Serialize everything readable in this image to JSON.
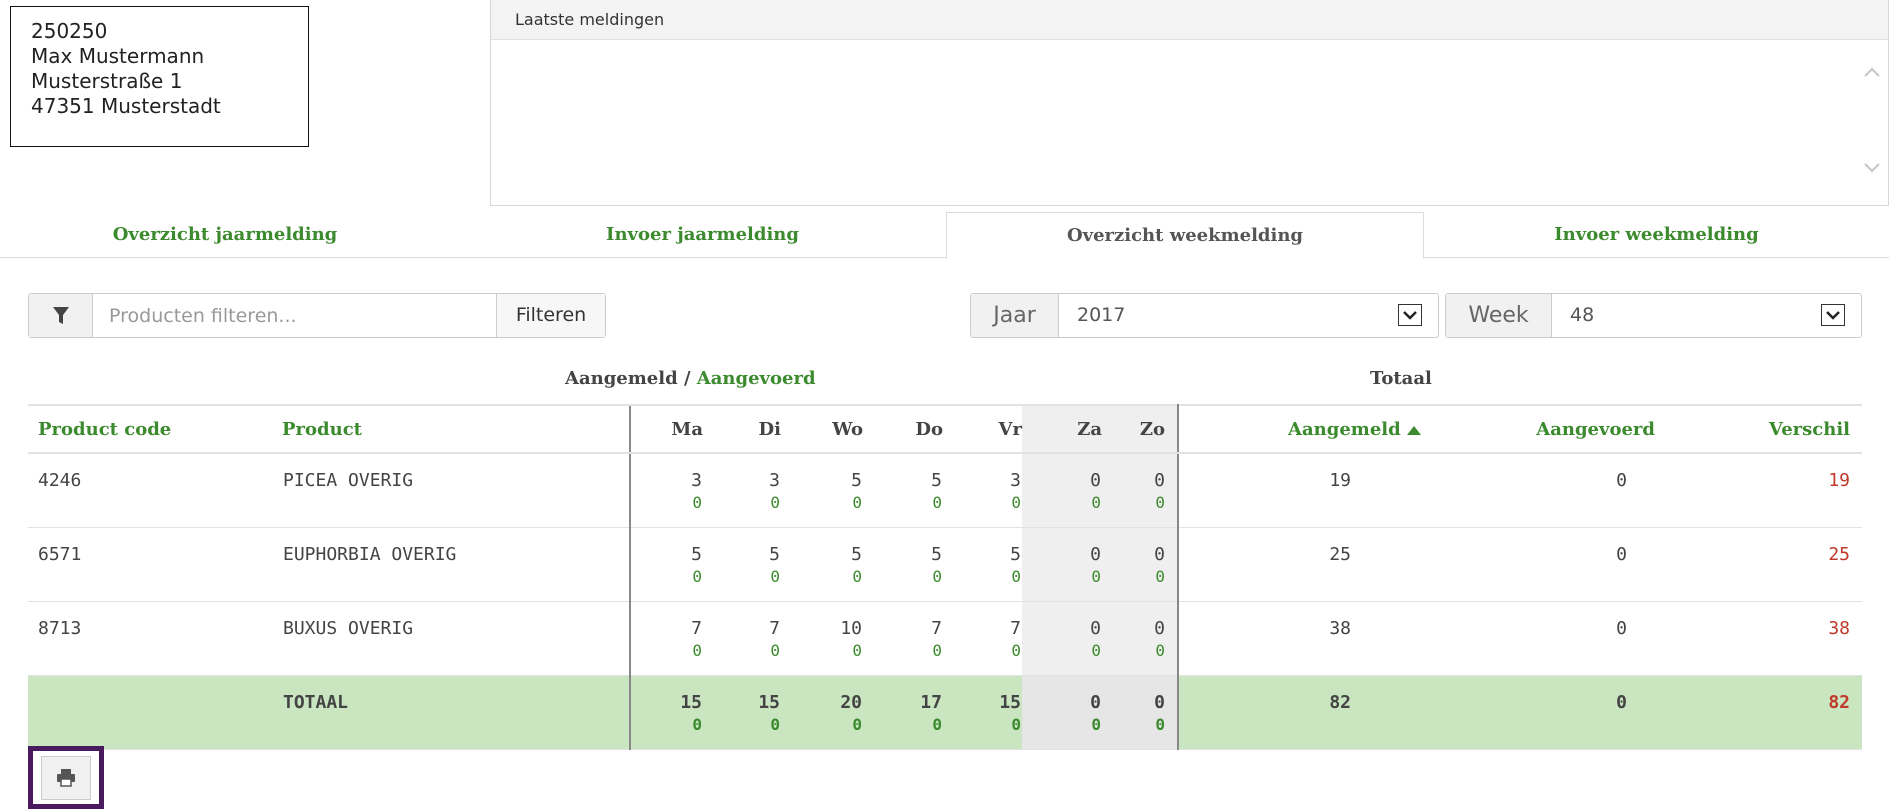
{
  "address": {
    "line1": "250250",
    "line2": "Max Mustermann",
    "line3": "Musterstraße 1",
    "line4": "47351 Musterstadt"
  },
  "notifications": {
    "title": "Laatste meldingen"
  },
  "tabs": [
    {
      "label": "Overzicht jaarmelding",
      "active": false
    },
    {
      "label": "Invoer jaarmelding",
      "active": false
    },
    {
      "label": "Overzicht weekmelding",
      "active": true
    },
    {
      "label": "Invoer weekmelding",
      "active": false
    }
  ],
  "filter": {
    "placeholder": "Producten filteren...",
    "button": "Filteren"
  },
  "year": {
    "label": "Jaar",
    "value": "2017"
  },
  "week": {
    "label": "Week",
    "value": "48"
  },
  "group_headers": {
    "aangemeld": "Aangemeld / ",
    "aangevoerd": "Aangevoerd",
    "totaal": "Totaal"
  },
  "columns": {
    "code": "Product code",
    "product": "Product",
    "days": [
      "Ma",
      "Di",
      "Wo",
      "Do",
      "Vr",
      "Za",
      "Zo"
    ],
    "aangemeld": "Aangemeld",
    "aangevoerd": "Aangevoerd",
    "verschil": "Verschil"
  },
  "rows": [
    {
      "code": "4246",
      "product": "PICEA OVERIG",
      "d": [
        [
          "3",
          "0"
        ],
        [
          "3",
          "0"
        ],
        [
          "5",
          "0"
        ],
        [
          "5",
          "0"
        ],
        [
          "3",
          "0"
        ],
        [
          "0",
          "0"
        ],
        [
          "0",
          "0"
        ]
      ],
      "aangemeld": "19",
      "aangevoerd": "0",
      "verschil": "19"
    },
    {
      "code": "6571",
      "product": "EUPHORBIA OVERIG",
      "d": [
        [
          "5",
          "0"
        ],
        [
          "5",
          "0"
        ],
        [
          "5",
          "0"
        ],
        [
          "5",
          "0"
        ],
        [
          "5",
          "0"
        ],
        [
          "0",
          "0"
        ],
        [
          "0",
          "0"
        ]
      ],
      "aangemeld": "25",
      "aangevoerd": "0",
      "verschil": "25"
    },
    {
      "code": "8713",
      "product": "BUXUS OVERIG",
      "d": [
        [
          "7",
          "0"
        ],
        [
          "7",
          "0"
        ],
        [
          "10",
          "0"
        ],
        [
          "7",
          "0"
        ],
        [
          "7",
          "0"
        ],
        [
          "0",
          "0"
        ],
        [
          "0",
          "0"
        ]
      ],
      "aangemeld": "38",
      "aangevoerd": "0",
      "verschil": "38"
    }
  ],
  "total": {
    "label": "TOTAAL",
    "d": [
      [
        "15",
        "0"
      ],
      [
        "15",
        "0"
      ],
      [
        "20",
        "0"
      ],
      [
        "17",
        "0"
      ],
      [
        "15",
        "0"
      ],
      [
        "0",
        "0"
      ],
      [
        "0",
        "0"
      ]
    ],
    "aangemeld": "82",
    "aangevoerd": "0",
    "verschil": "82"
  },
  "colors": {
    "accent_green": "#3c8a2e",
    "total_bg": "#c9e6c1",
    "diff_red": "#c0392b",
    "print_border": "#4a1a5e"
  },
  "icons": {
    "filter": "filter-icon",
    "print": "printer-icon",
    "sort": "sort-asc-icon",
    "caret": "chevron-down-icon"
  }
}
